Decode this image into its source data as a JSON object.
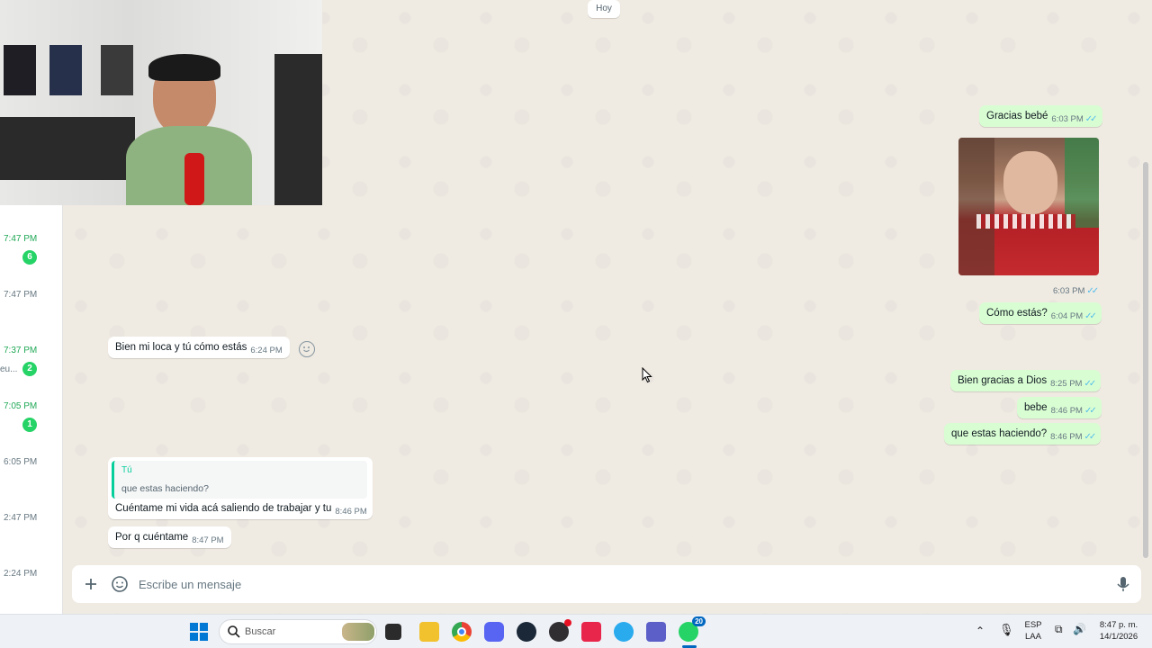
{
  "chat": {
    "day_separator": "Hoy",
    "messages": [
      {
        "text": "Gracias bebé",
        "time": "6:03 PM"
      },
      {
        "time": "6:03 PM"
      },
      {
        "text": "Cómo estás?",
        "time": "6:04 PM"
      },
      {
        "text": "Bien mi loca y tú cómo estás",
        "time": "6:24 PM"
      },
      {
        "text": "Bien gracias a Dios",
        "time": "8:25 PM"
      },
      {
        "text": "bebe",
        "time": "8:46 PM"
      },
      {
        "text": "que estas haciendo?",
        "time": "8:46 PM"
      },
      {
        "quote_author": "Tú",
        "quote_text": "que estas haciendo?",
        "text": "Cuéntame mi vida acá saliendo de trabajar y tu",
        "time": "8:46 PM"
      },
      {
        "text": "Por q cuéntame",
        "time": "8:47 PM"
      }
    ],
    "read_ticks": "✓✓"
  },
  "sidebar": {
    "items": [
      {
        "time": "7:47 PM",
        "unread": "6"
      },
      {
        "time": "7:47 PM"
      },
      {
        "time": "7:37 PM",
        "snippet": "eu...",
        "unread": "2"
      },
      {
        "time": "7:05 PM",
        "unread": "1"
      },
      {
        "time": "6:05 PM"
      },
      {
        "time": "2:47 PM"
      },
      {
        "time": "2:24 PM"
      }
    ]
  },
  "composer": {
    "placeholder": "Escribe un mensaje",
    "attach_icon": "plus-icon",
    "sticker_icon": "sticker-icon",
    "mic_icon": "mic-icon"
  },
  "taskbar": {
    "search_placeholder": "Buscar",
    "whatsapp_badge": "20",
    "language": "ESP",
    "layout": "LAA",
    "clock_time": "8:47 p. m.",
    "clock_date": "14/1/2026",
    "apps": [
      "windows-start-icon",
      "search-icon",
      "task-view-icon",
      "file-explorer-icon",
      "chrome-icon",
      "discord-icon",
      "steam-icon",
      "obs-icon",
      "tiktok-icon",
      "telegram-icon",
      "teams-icon",
      "whatsapp-icon"
    ]
  },
  "colors": {
    "outgoing_bubble": "#d9fdd3",
    "incoming_bubble": "#ffffff",
    "chat_background": "#efeae2",
    "unread_badge": "#25d366",
    "read_ticks": "#53bdeb"
  }
}
